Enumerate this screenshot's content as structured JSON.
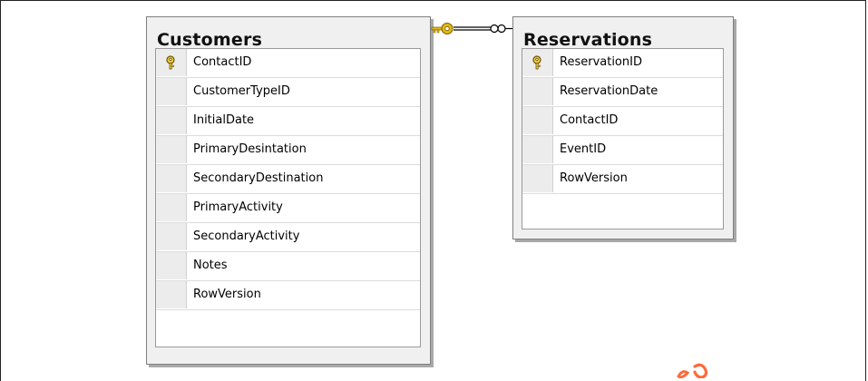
{
  "customers": {
    "title": "Customers",
    "columns": [
      {
        "name": "ContactID",
        "primary_key": true
      },
      {
        "name": "CustomerTypeID",
        "primary_key": false
      },
      {
        "name": "InitialDate",
        "primary_key": false
      },
      {
        "name": "PrimaryDesintation",
        "primary_key": false
      },
      {
        "name": "SecondaryDestination",
        "primary_key": false
      },
      {
        "name": "PrimaryActivity",
        "primary_key": false
      },
      {
        "name": "SecondaryActivity",
        "primary_key": false
      },
      {
        "name": "Notes",
        "primary_key": false
      },
      {
        "name": "RowVersion",
        "primary_key": false
      }
    ]
  },
  "reservations": {
    "title": "Reservations",
    "columns": [
      {
        "name": "ReservationID",
        "primary_key": true
      },
      {
        "name": "ReservationDate",
        "primary_key": false
      },
      {
        "name": "ContactID",
        "primary_key": false
      },
      {
        "name": "EventID",
        "primary_key": false
      },
      {
        "name": "RowVersion",
        "primary_key": false
      }
    ]
  },
  "relationship": {
    "from_table": "Customers",
    "to_table": "Reservations",
    "from_end": "key-icon",
    "to_end": "infinity-icon"
  },
  "colors": {
    "key_gold": "#e2b814",
    "table_bg": "#f0f0f0",
    "table_border": "#808080",
    "watermark": "#ff6a3c"
  }
}
